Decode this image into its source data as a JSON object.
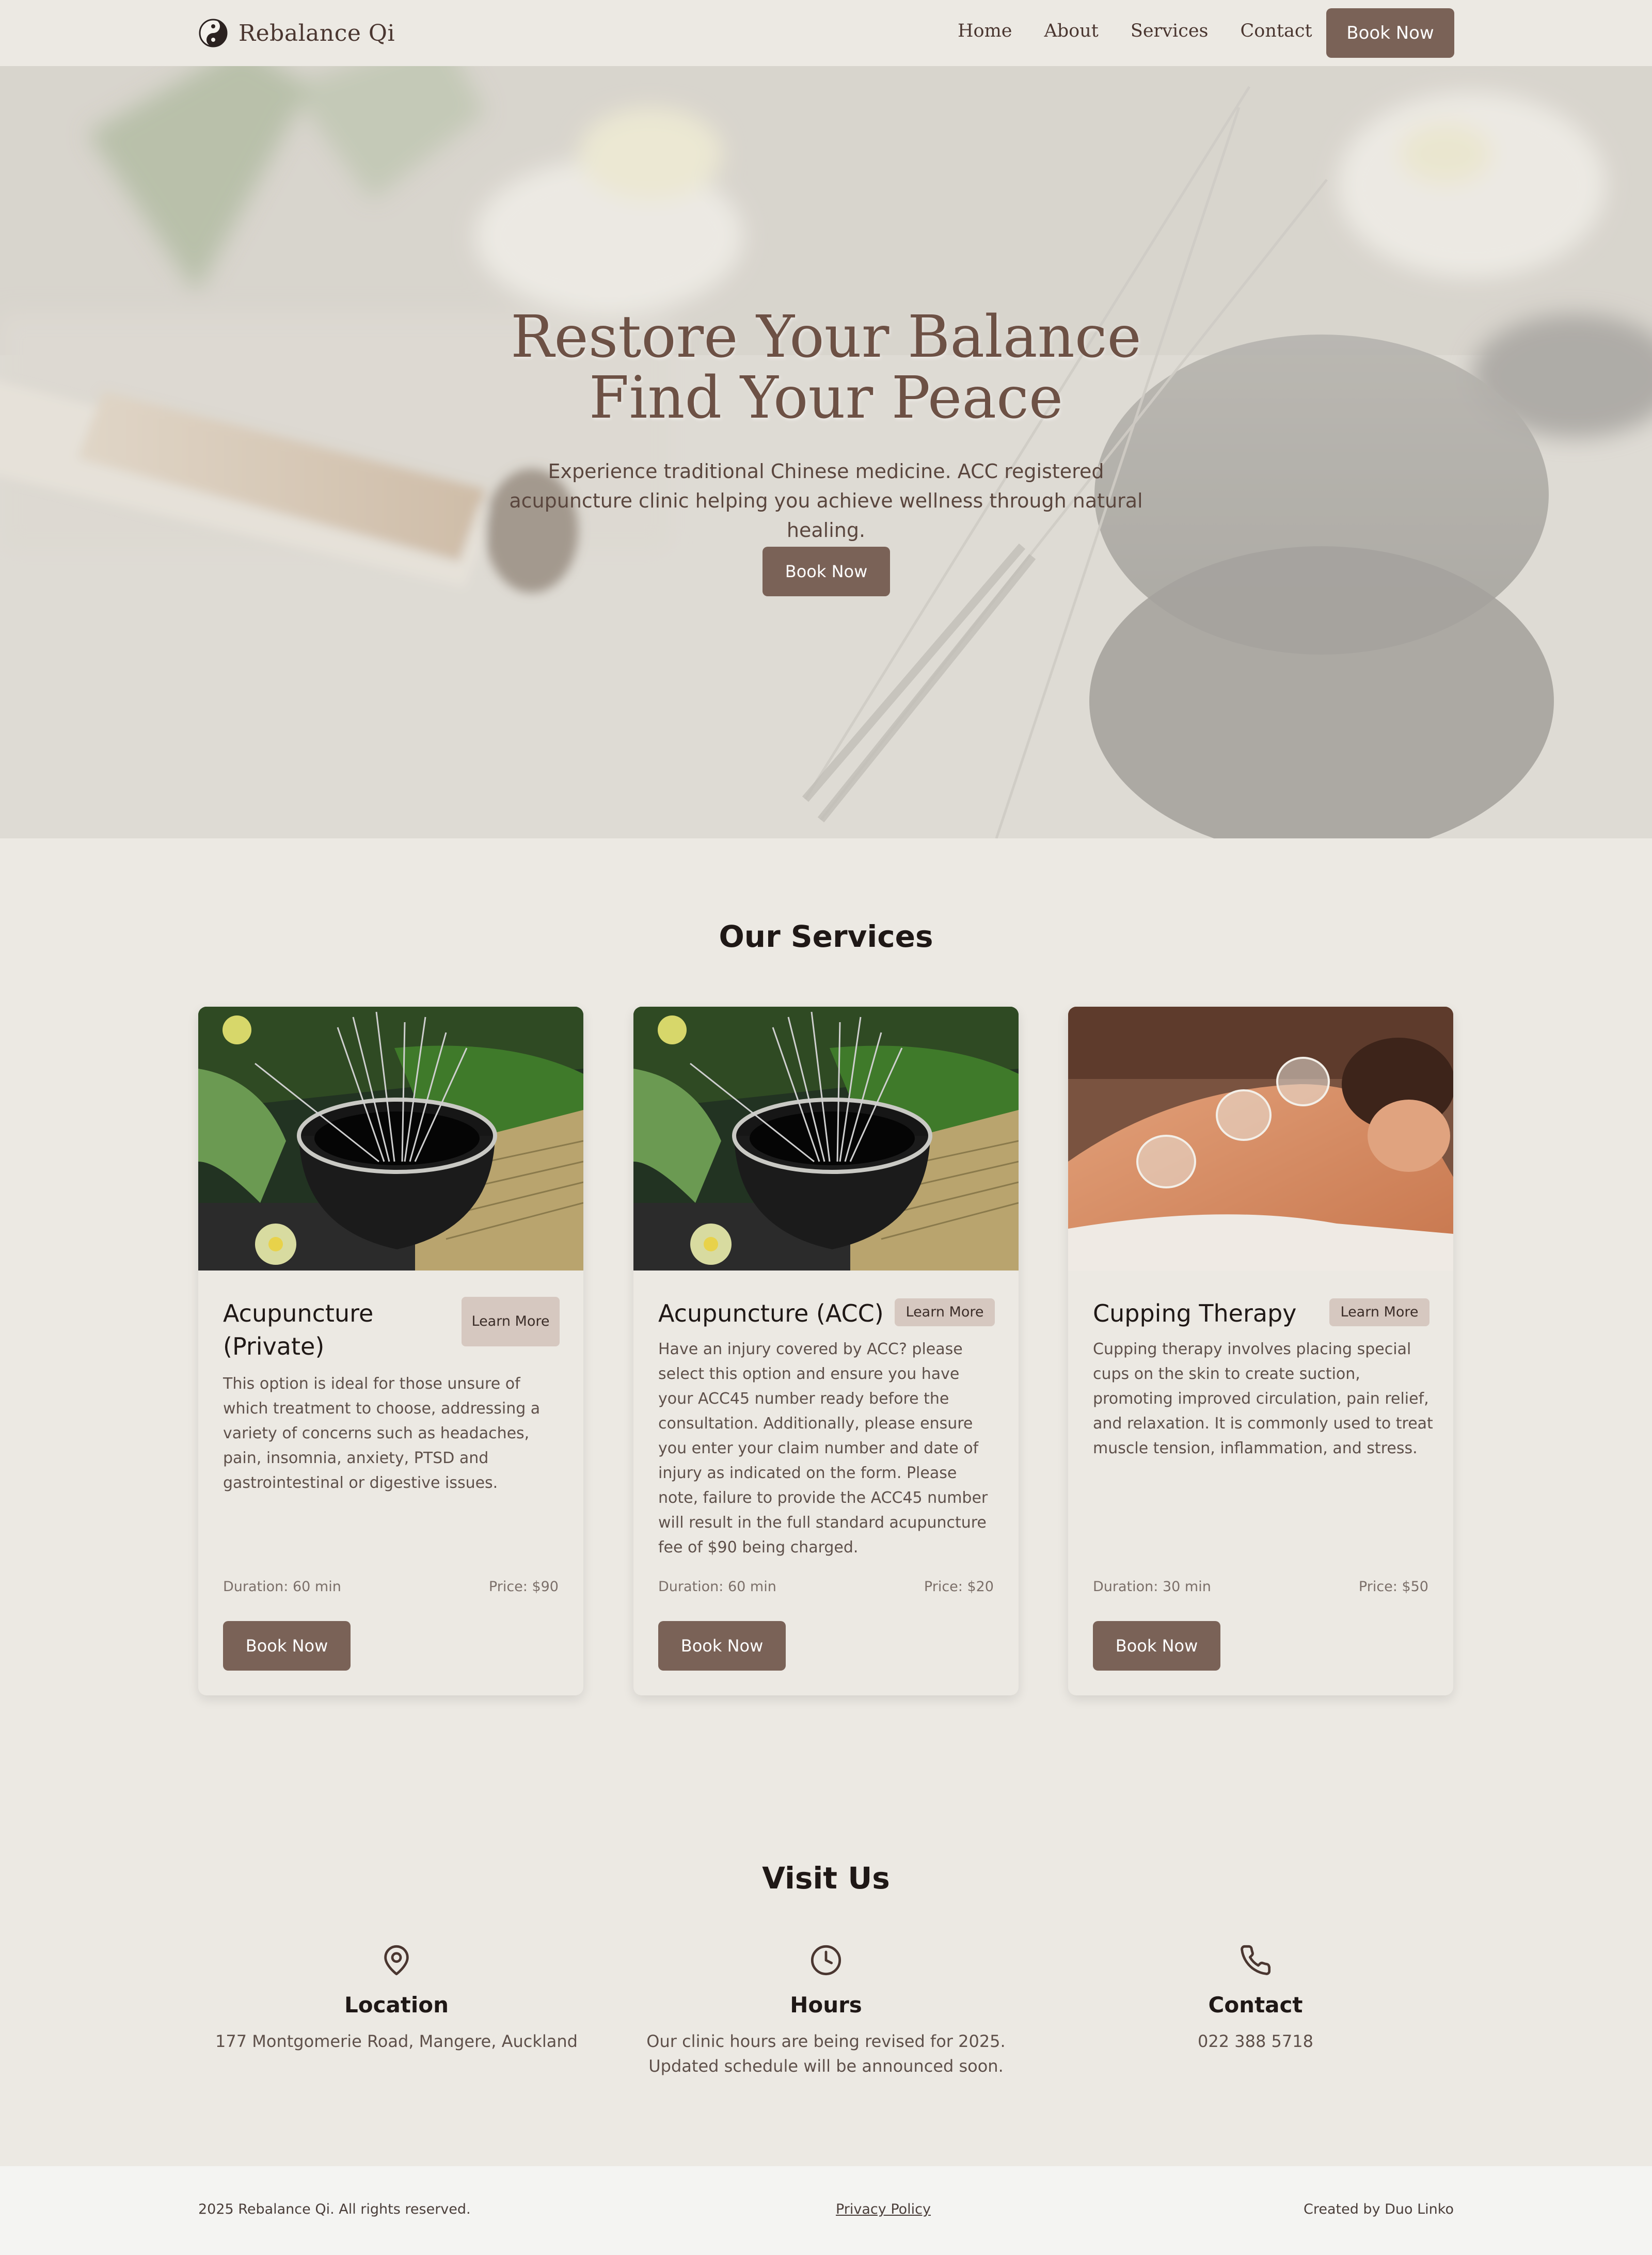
{
  "colors": {
    "accent": "#7a6257",
    "background": "#ece9e3",
    "heading": "#1f1816",
    "learn_more_bg": "#d6c8c0",
    "footer_bg": "#f4f4f2"
  },
  "nav": {
    "logo_icon": "yin-yang-icon",
    "brand": "Rebalance Qi",
    "links": [
      "Home",
      "About",
      "Services",
      "Contact"
    ],
    "book_label": "Book Now"
  },
  "hero": {
    "title_line1": "Restore Your Balance",
    "title_line2": "Find Your Peace",
    "subtitle": "Experience traditional Chinese medicine. ACC registered acupuncture clinic helping you achieve wellness through natural healing.",
    "book_label": "Book Now"
  },
  "services": {
    "heading": "Our Services",
    "cards": [
      {
        "title": "Acupuncture (Private)",
        "learn_more": "Learn More",
        "description": "This option is ideal for those unsure of which treatment to choose, addressing a variety of concerns such as headaches, pain, insomnia, anxiety, PTSD and gastrointestinal or digestive issues.",
        "duration": "Duration: 60 min",
        "price": "Price: $90",
        "book_label": "Book Now"
      },
      {
        "title": "Acupuncture (ACC)",
        "learn_more": "Learn More",
        "description": "Have an injury covered by ACC? please select this option and ensure you have your ACC45 number ready before the consultation. Additionally, please ensure you enter your claim number and date of injury as indicated on the form. Please note, failure to provide the ACC45 number will result in the full standard acupuncture fee of $90 being charged.",
        "duration": "Duration: 60 min",
        "price": "Price: $20",
        "book_label": "Book Now"
      },
      {
        "title": "Cupping Therapy",
        "learn_more": "Learn More",
        "description": "Cupping therapy involves placing special cups on the skin to create suction, promoting improved circulation, pain relief, and relaxation. It is commonly used to treat muscle tension, inflammation, and stress.",
        "duration": "Duration: 30 min",
        "price": "Price: $50",
        "book_label": "Book Now"
      }
    ]
  },
  "visit": {
    "heading": "Visit Us",
    "items": [
      {
        "icon": "map-pin-icon",
        "title": "Location",
        "text": "177 Montgomerie Road, Mangere, Auckland"
      },
      {
        "icon": "clock-icon",
        "title": "Hours",
        "text": "Our clinic hours are being revised for 2025. Updated schedule will be announced soon."
      },
      {
        "icon": "phone-icon",
        "title": "Contact",
        "text": "022 388 5718"
      }
    ]
  },
  "footer": {
    "copyright": "2025 Rebalance Qi. All rights reserved.",
    "privacy": "Privacy Policy",
    "credit": "Created by Duo Linko"
  }
}
